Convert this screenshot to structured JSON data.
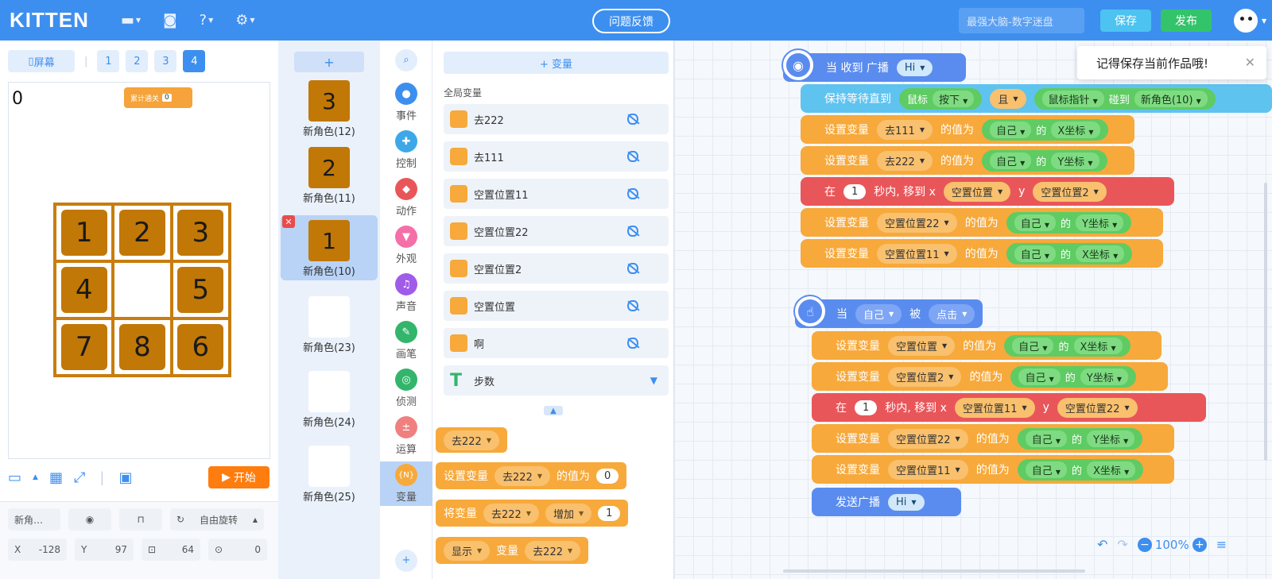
{
  "app": {
    "logo": "KITTEN",
    "feedback": "问题反馈",
    "title_placeholder": "最强大脑-数字迷盘",
    "save": "保存",
    "publish": "发布"
  },
  "stage": {
    "fullscreen": "屏幕",
    "scenes": [
      "1",
      "2",
      "3",
      "4"
    ],
    "active_scene": "4",
    "score": "0",
    "badge_label": "累计通关",
    "badge_count": "0",
    "tiles": [
      "1",
      "2",
      "3",
      "4",
      "",
      "5",
      "7",
      "8",
      "6"
    ],
    "start": "开始"
  },
  "sprite_props": {
    "name": "新角…",
    "rotation": "自由旋转",
    "x_label": "X",
    "x": "-128",
    "y_label": "Y",
    "y": "97",
    "size": "64",
    "direction": "0"
  },
  "sprites": [
    {
      "name": "新角色(12)",
      "digit": "3"
    },
    {
      "name": "新角色(11)",
      "digit": "2"
    },
    {
      "name": "新角色(10)",
      "digit": "1"
    },
    {
      "name": "新角色(23)",
      "digit": ""
    },
    {
      "name": "新角色(24)",
      "digit": ""
    },
    {
      "name": "新角色(25)",
      "digit": ""
    }
  ],
  "categories": [
    {
      "label": "事件",
      "color": "#3d8fef"
    },
    {
      "label": "控制",
      "color": "#3da8e8"
    },
    {
      "label": "动作",
      "color": "#e9565a"
    },
    {
      "label": "外观",
      "color": "#f56fa8"
    },
    {
      "label": "声音",
      "color": "#a05ce8"
    },
    {
      "label": "画笔",
      "color": "#33b56b"
    },
    {
      "label": "侦测",
      "color": "#33b56b"
    },
    {
      "label": "运算",
      "color": "#f08080"
    },
    {
      "label": "变量",
      "color": "#f7a93b"
    }
  ],
  "variables": {
    "add": "+ 变量",
    "global_label": "全局变量",
    "items": [
      "去222",
      "去111",
      "空置位置11",
      "空置位置22",
      "空置位置2",
      "空置位置",
      "啊"
    ],
    "list_label": "步数",
    "reporter": "去222",
    "set_label": "设置变量",
    "set_var": "去222",
    "set_value_label": "的值为",
    "set_value": "0",
    "change_label": "将变量",
    "change_var": "去222",
    "change_op": "增加",
    "change_value": "1",
    "show_label": "显示",
    "show_mid": "变量",
    "show_var": "去222"
  },
  "script1": {
    "hat_label": "当 收到 广播",
    "hat_msg": "Hi",
    "wait_label": "保持等待直到",
    "mouse": "鼠标",
    "pressed": "按下",
    "and": "且",
    "pointer": "鼠标指针",
    "touch": "碰到",
    "sprite": "新角色(10)",
    "rows": [
      {
        "var": "去111",
        "obj": "自己",
        "prop": "X坐标"
      },
      {
        "var": "去222",
        "obj": "自己",
        "prop": "Y坐标"
      }
    ],
    "move": {
      "in": "在",
      "secs": "1",
      "mid": "秒内, 移到 x",
      "x": "空置位置",
      "y_label": "y",
      "y": "空置位置2"
    },
    "rows2": [
      {
        "var": "空置位置22",
        "obj": "自己",
        "prop": "Y坐标"
      },
      {
        "var": "空置位置11",
        "obj": "自己",
        "prop": "X坐标"
      }
    ]
  },
  "script2": {
    "hat_when": "当",
    "hat_obj": "自己",
    "hat_is": "被",
    "hat_event": "点击",
    "rows": [
      {
        "var": "空置位置",
        "obj": "自己",
        "prop": "X坐标"
      },
      {
        "var": "空置位置2",
        "obj": "自己",
        "prop": "Y坐标"
      }
    ],
    "move": {
      "in": "在",
      "secs": "1",
      "mid": "秒内, 移到 x",
      "x": "空置位置11",
      "y_label": "y",
      "y": "空置位置22"
    },
    "rows2": [
      {
        "var": "空置位置22",
        "obj": "自己",
        "prop": "Y坐标"
      },
      {
        "var": "空置位置11",
        "obj": "自己",
        "prop": "X坐标"
      }
    ],
    "broadcast_label": "发送广播",
    "broadcast_msg": "Hi"
  },
  "labels": {
    "set": "设置变量",
    "value_of": "的值为",
    "of": "的"
  },
  "toast": "记得保存当前作品哦!",
  "zoom": "100%"
}
